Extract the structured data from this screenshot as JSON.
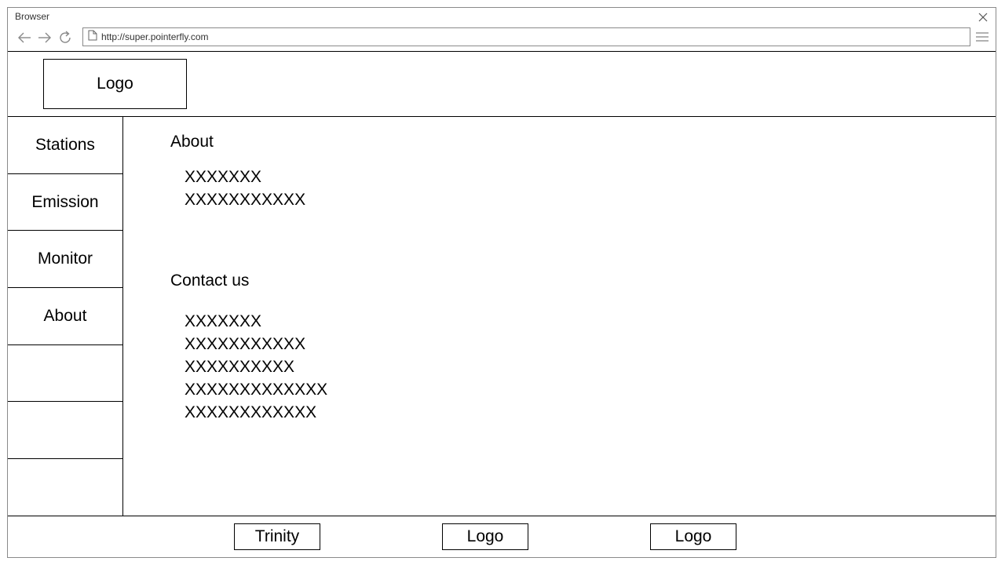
{
  "window": {
    "title": "Browser"
  },
  "address_bar": {
    "url": "http://super.pointerfly.com"
  },
  "icons": {
    "back": "arrow-left-icon",
    "forward": "arrow-right-icon",
    "reload": "reload-icon",
    "page": "page-icon",
    "menu": "hamburger-menu-icon",
    "close": "close-icon"
  },
  "header": {
    "logo": "Logo"
  },
  "sidebar": {
    "items": [
      {
        "label": "Stations"
      },
      {
        "label": "Emission"
      },
      {
        "label": "Monitor"
      },
      {
        "label": "About"
      },
      {
        "label": ""
      },
      {
        "label": ""
      },
      {
        "label": ""
      }
    ]
  },
  "main": {
    "about": {
      "title": "About",
      "lines": [
        "XXXXXXX",
        "XXXXXXXXXXX"
      ]
    },
    "contact": {
      "title": "Contact us",
      "lines": [
        "XXXXXXX",
        "XXXXXXXXXXX",
        "XXXXXXXXXX",
        "XXXXXXXXXXXXX",
        "XXXXXXXXXXXX"
      ]
    }
  },
  "footer": {
    "items": [
      {
        "label": "Trinity"
      },
      {
        "label": "Logo"
      },
      {
        "label": "Logo"
      }
    ]
  }
}
